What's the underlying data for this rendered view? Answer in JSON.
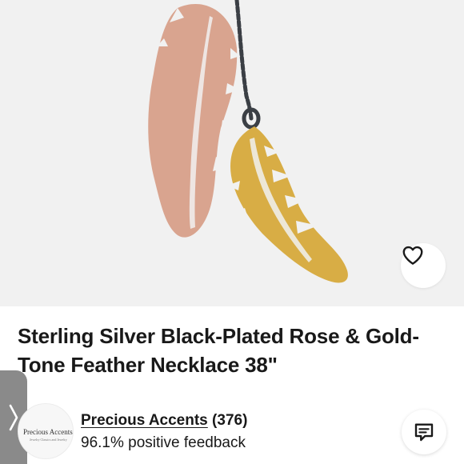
{
  "listing": {
    "title": "Sterling Silver Black-Plated Rose & Gold-Tone Feather Necklace 38\""
  },
  "image": {
    "subject": "rose-and-gold-feather-pendants-on-black-chain",
    "colors": {
      "background": "#f1f1f1",
      "rose": "#d9a48f",
      "gold": "#d8ad45",
      "chain": "#3b3f45"
    }
  },
  "actions": {
    "favorite_icon": "heart-outline-icon",
    "message_icon": "chat-bubble-icon",
    "side_tab_icon": "chevron-right-icon"
  },
  "seller": {
    "name": "Precious Accents",
    "rating_count": "(376)",
    "feedback": "96.1% positive feedback",
    "avatar_logo_text": "Precious Accents",
    "avatar_logo_subtext": "Jewelry Classics and Jewelry"
  }
}
